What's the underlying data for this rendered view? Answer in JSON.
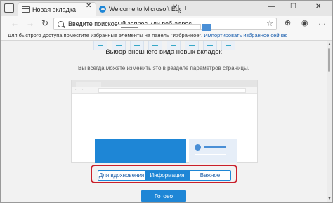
{
  "tabs": [
    {
      "title": "Новая вкладка",
      "active": true,
      "close": "✕"
    },
    {
      "title": "Welcome to Microsoft Edge De",
      "active": false,
      "close": "✕"
    }
  ],
  "tabbar": {
    "new_tab": "+",
    "minimize": "—",
    "maximize": "☐",
    "close": "✕"
  },
  "nav": {
    "back": "←",
    "forward": "→",
    "refresh": "↻"
  },
  "address": {
    "placeholder": "Введите поисковый запрос или веб-адрес",
    "star": "☆"
  },
  "toolbar": {
    "collections": "⊕",
    "profile": "◉",
    "menu": "…"
  },
  "favbar": {
    "text": "Для быстрого доступа поместите избранные элементы на панель \"Избранное\".",
    "link": "Импортировать избранное сейчас"
  },
  "page": {
    "heading": "Выбор внешнего вида новых вкладок",
    "subtext": "Вы всегда можете изменить это в разделе параметров страницы."
  },
  "preview_nav": {
    "arrows": "← →"
  },
  "options": [
    {
      "label": "Для вдохновения",
      "selected": false
    },
    {
      "label": "Информация",
      "selected": true
    },
    {
      "label": "Важное",
      "selected": false
    }
  ],
  "done": "Готово",
  "scrollbar": {
    "up": "▲",
    "down": "▼"
  },
  "colors": {
    "accent": "#1e86d6",
    "highlight": "#c91f2b",
    "link": "#1b5fae"
  }
}
